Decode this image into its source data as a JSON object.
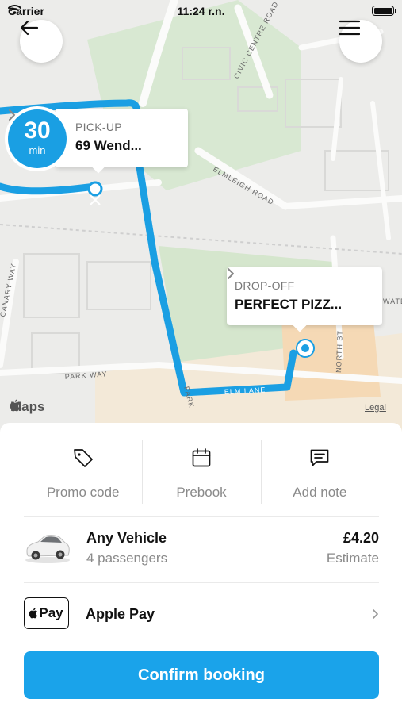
{
  "status_bar": {
    "carrier": "Carrier",
    "time": "11:24 r.n."
  },
  "map": {
    "pickup": {
      "eta_value": "30",
      "eta_unit": "min",
      "kicker": "PICK-UP",
      "address": "69 Wend..."
    },
    "dropoff": {
      "kicker": "DROP-OFF",
      "address": "PERFECT PIZZ..."
    },
    "street_labels": [
      "CIVIC CENTRE ROAD",
      "ELMLEIGH ROAD",
      "PARK WAY",
      "ELM LANE",
      "PARK",
      "NORTH ST",
      "WATE",
      "CANARY WAY"
    ],
    "attribution": {
      "logo_text": "Maps",
      "legal": "Legal"
    },
    "route_color": "#1a9fe3"
  },
  "actions": [
    {
      "label": "Promo code",
      "icon": "tag-icon"
    },
    {
      "label": "Prebook",
      "icon": "calendar-icon"
    },
    {
      "label": "Add note",
      "icon": "message-icon"
    }
  ],
  "vehicle": {
    "name": "Any Vehicle",
    "passengers": "4 passengers",
    "price": "£4.20",
    "price_note": "Estimate",
    "icon": "car-image"
  },
  "payment": {
    "badge_text": "Pay",
    "method": "Apple Pay"
  },
  "confirm_label": "Confirm booking",
  "accent_color": "#1aa3ea"
}
